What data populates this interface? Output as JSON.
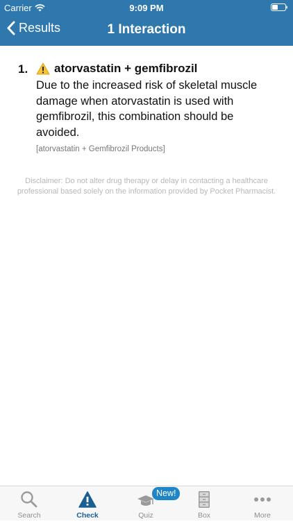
{
  "status_bar": {
    "carrier": "Carrier",
    "time": "9:09 PM"
  },
  "nav": {
    "back_label": "Results",
    "title": "1 Interaction"
  },
  "interactions": [
    {
      "number": "1.",
      "title": "atorvastatin + gemfibrozil",
      "description": "Due to the increased risk of skeletal muscle damage when atorvastatin is used with gemfibrozil, this combination should be avoided.",
      "products": "[atorvastatin + Gemfibrozil Products]"
    }
  ],
  "disclaimer": "Disclaimer: Do not alter drug therapy or delay in contacting a healthcare professional based solely on the information provided by Pocket Pharmacist.",
  "tabs": [
    {
      "label": "Search",
      "icon": "magnifier-icon"
    },
    {
      "label": "Check",
      "icon": "warning-triangle-icon",
      "active": true
    },
    {
      "label": "Quiz",
      "icon": "graduation-cap-icon"
    },
    {
      "label": "Box",
      "icon": "cabinet-icon"
    },
    {
      "label": "More",
      "icon": "ellipsis-icon"
    }
  ],
  "quiz_badge": "New!",
  "colors": {
    "header": "#2f78ad",
    "active_tab": "#1a5f92",
    "badge": "#1e86c7",
    "warning": "#f7c331"
  }
}
